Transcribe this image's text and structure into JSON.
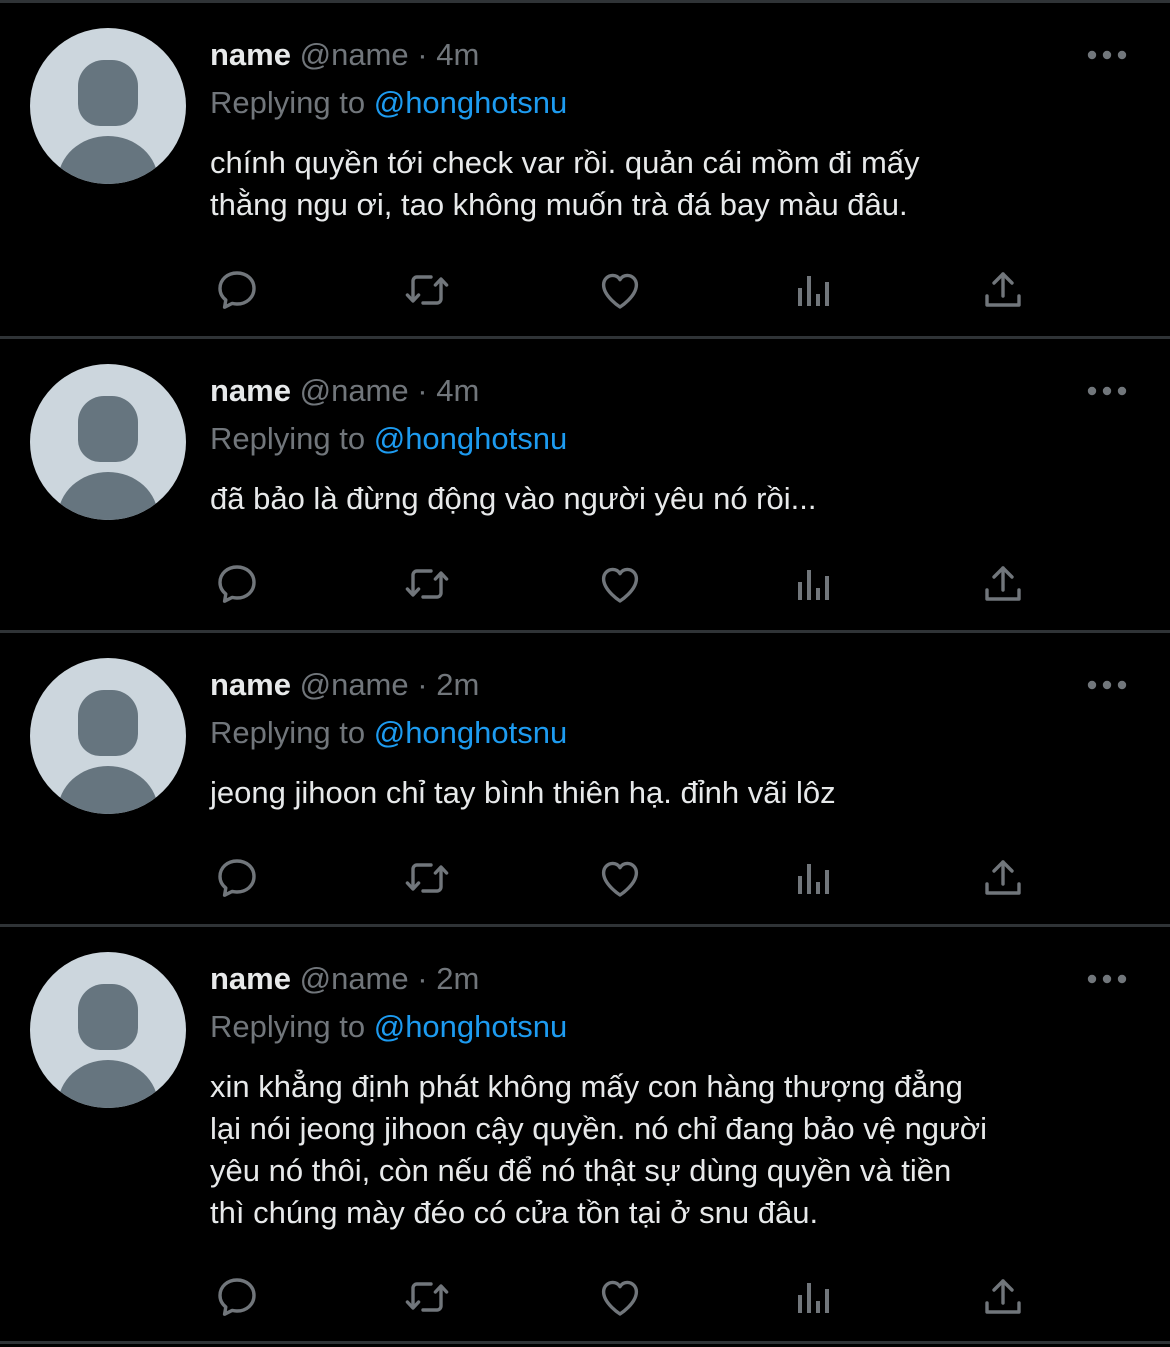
{
  "theme": {
    "background": "#000000",
    "divider": "#2f3336",
    "text_primary": "#e7e9ea",
    "text_secondary": "#71767b",
    "accent": "#1d9bf0"
  },
  "tweets": [
    {
      "display_name": "name",
      "handle": "@name",
      "separator": "·",
      "time": "4m",
      "replying_prefix": "Replying to",
      "replying_to": "@honghotsnu",
      "text": "chính quyền tới check var rồi. quản cái mồm đi mấy\nthằng ngu ơi, tao không muốn trà đá bay màu đâu.",
      "icons": {
        "avatar": "default-avatar-icon",
        "more": "more-dots-icon",
        "reply": "reply-bubble-icon",
        "retweet": "retweet-icon",
        "like": "heart-icon",
        "analytics": "analytics-icon",
        "share": "share-icon"
      }
    },
    {
      "display_name": "name",
      "handle": "@name",
      "separator": "·",
      "time": "4m",
      "replying_prefix": "Replying to",
      "replying_to": "@honghotsnu",
      "text": "đã bảo là đừng động vào người yêu nó rồi...",
      "icons": {
        "avatar": "default-avatar-icon",
        "more": "more-dots-icon",
        "reply": "reply-bubble-icon",
        "retweet": "retweet-icon",
        "like": "heart-icon",
        "analytics": "analytics-icon",
        "share": "share-icon"
      }
    },
    {
      "display_name": "name",
      "handle": "@name",
      "separator": "·",
      "time": "2m",
      "replying_prefix": "Replying to",
      "replying_to": "@honghotsnu",
      "text": "jeong jihoon chỉ tay bình thiên hạ. đỉnh vãi lôz",
      "icons": {
        "avatar": "default-avatar-icon",
        "more": "more-dots-icon",
        "reply": "reply-bubble-icon",
        "retweet": "retweet-icon",
        "like": "heart-icon",
        "analytics": "analytics-icon",
        "share": "share-icon"
      }
    },
    {
      "display_name": "name",
      "handle": "@name",
      "separator": "·",
      "time": "2m",
      "replying_prefix": "Replying to",
      "replying_to": "@honghotsnu",
      "text": "xin khẳng định phát không mấy con hàng thượng đẳng\nlại nói jeong jihoon cậy quyền. nó chỉ đang bảo vệ người\nyêu nó thôi, còn nếu để nó thật sự dùng quyền và tiền\nthì chúng mày đéo có cửa tồn tại ở snu đâu.",
      "icons": {
        "avatar": "default-avatar-icon",
        "more": "more-dots-icon",
        "reply": "reply-bubble-icon",
        "retweet": "retweet-icon",
        "like": "heart-icon",
        "analytics": "analytics-icon",
        "share": "share-icon"
      }
    }
  ]
}
